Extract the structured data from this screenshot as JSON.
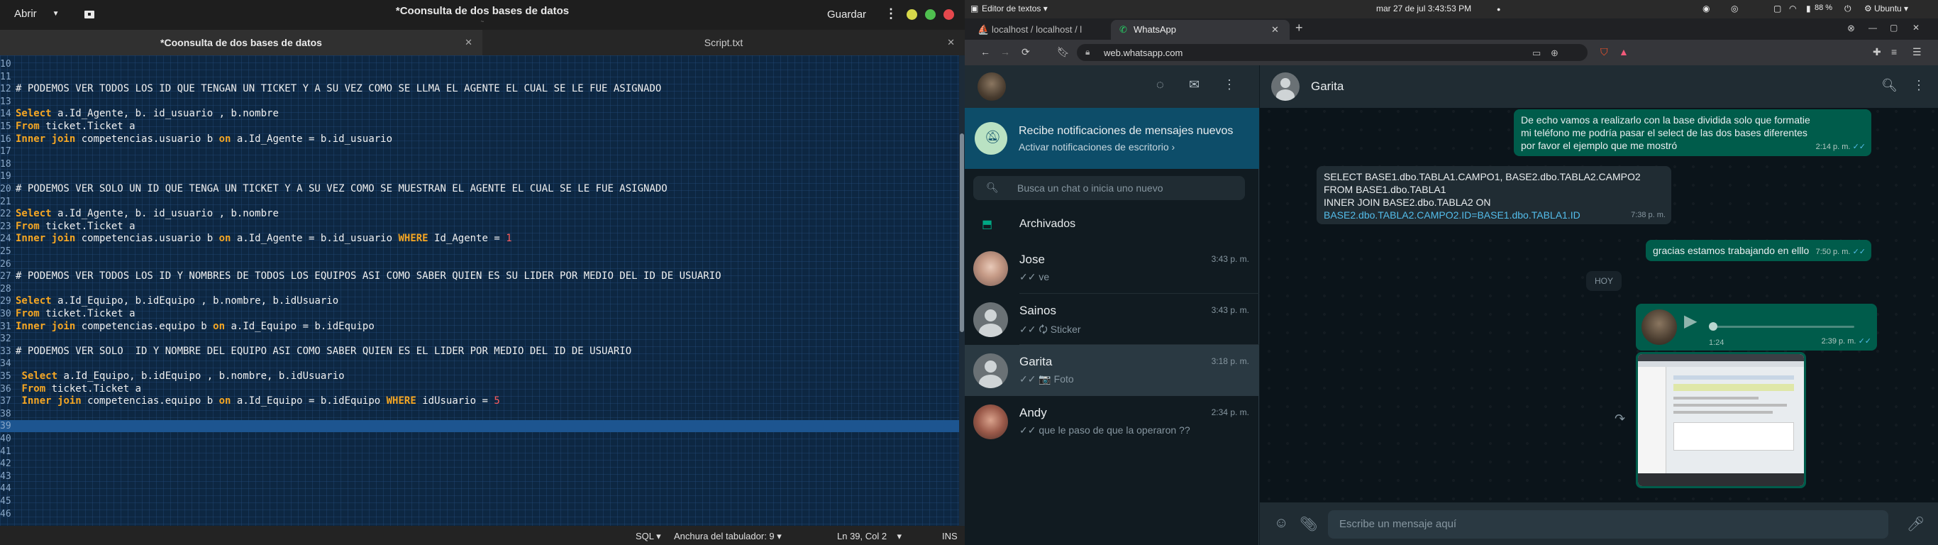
{
  "gedit": {
    "open_label": "Abrir",
    "title": "*Coonsulta de dos bases de datos",
    "subtitle": "~",
    "save_label": "Guardar",
    "tabs": [
      {
        "label": "*Coonsulta de dos bases de datos"
      },
      {
        "label": "Script.txt"
      }
    ],
    "lines": [
      {
        "n": "10",
        "parts": []
      },
      {
        "n": "11",
        "parts": []
      },
      {
        "n": "12",
        "parts": [
          {
            "t": "# PODEMOS VER TODOS LOS ID QUE TENGAN UN TICKET Y A SU VEZ COMO SE LLMA EL AGENTE EL CUAL SE LE FUE ASIGNADO"
          }
        ]
      },
      {
        "n": "13",
        "parts": []
      },
      {
        "n": "14",
        "parts": [
          {
            "t": "Select",
            "c": "kw"
          },
          {
            "t": " a.Id_Agente, b. id_usuario , b.nombre"
          }
        ]
      },
      {
        "n": "15",
        "parts": [
          {
            "t": "From",
            "c": "kw"
          },
          {
            "t": " ticket.Ticket a"
          }
        ]
      },
      {
        "n": "16",
        "parts": [
          {
            "t": "Inner join",
            "c": "kw"
          },
          {
            "t": " competencias.usuario b "
          },
          {
            "t": "on",
            "c": "kw"
          },
          {
            "t": " a.Id_Agente = b.id_usuario"
          }
        ]
      },
      {
        "n": "17",
        "parts": []
      },
      {
        "n": "18",
        "parts": []
      },
      {
        "n": "19",
        "parts": []
      },
      {
        "n": "20",
        "parts": [
          {
            "t": "# PODEMOS VER SOLO UN ID QUE TENGA UN TICKET Y A SU VEZ COMO SE MUESTRAN EL AGENTE EL CUAL SE LE FUE ASIGNADO"
          }
        ]
      },
      {
        "n": "21",
        "parts": []
      },
      {
        "n": "22",
        "parts": [
          {
            "t": "Select",
            "c": "kw"
          },
          {
            "t": " a.Id_Agente, b. id_usuario , b.nombre"
          }
        ]
      },
      {
        "n": "23",
        "parts": [
          {
            "t": "From",
            "c": "kw"
          },
          {
            "t": " ticket.Ticket a"
          }
        ]
      },
      {
        "n": "24",
        "parts": [
          {
            "t": "Inner join",
            "c": "kw"
          },
          {
            "t": " competencias.usuario b "
          },
          {
            "t": "on",
            "c": "kw"
          },
          {
            "t": " a.Id_Agente = b.id_usuario "
          },
          {
            "t": "WHERE",
            "c": "kw"
          },
          {
            "t": " Id_Agente = "
          },
          {
            "t": "1",
            "c": "num"
          }
        ]
      },
      {
        "n": "25",
        "parts": []
      },
      {
        "n": "26",
        "parts": []
      },
      {
        "n": "27",
        "parts": [
          {
            "t": "# PODEMOS VER TODOS LOS ID Y NOMBRES DE TODOS LOS EQUIPOS ASI COMO SABER QUIEN ES SU LIDER POR MEDIO DEL ID DE USUARIO"
          }
        ]
      },
      {
        "n": "28",
        "parts": []
      },
      {
        "n": "29",
        "parts": [
          {
            "t": "Select",
            "c": "kw"
          },
          {
            "t": " a.Id_Equipo, b.idEquipo , b.nombre, b.idUsuario"
          }
        ]
      },
      {
        "n": "30",
        "parts": [
          {
            "t": "From",
            "c": "kw"
          },
          {
            "t": " ticket.Ticket a"
          }
        ]
      },
      {
        "n": "31",
        "parts": [
          {
            "t": "Inner join",
            "c": "kw"
          },
          {
            "t": " competencias.equipo b "
          },
          {
            "t": "on",
            "c": "kw"
          },
          {
            "t": " a.Id_Equipo = b.idEquipo"
          }
        ]
      },
      {
        "n": "32",
        "parts": []
      },
      {
        "n": "33",
        "parts": [
          {
            "t": "# PODEMOS VER SOLO  ID Y NOMBRE DEL EQUIPO ASI COMO SABER QUIEN ES EL LIDER POR MEDIO DEL ID DE USUARIO"
          }
        ]
      },
      {
        "n": "34",
        "parts": []
      },
      {
        "n": "35",
        "parts": [
          {
            "t": " "
          },
          {
            "t": "Select",
            "c": "kw"
          },
          {
            "t": " a.Id_Equipo, b.idEquipo , b.nombre, b.idUsuario"
          }
        ]
      },
      {
        "n": "36",
        "parts": [
          {
            "t": " "
          },
          {
            "t": "From",
            "c": "kw"
          },
          {
            "t": " ticket.Ticket a"
          }
        ]
      },
      {
        "n": "37",
        "parts": [
          {
            "t": " "
          },
          {
            "t": "Inner join",
            "c": "kw"
          },
          {
            "t": " competencias.equipo b "
          },
          {
            "t": "on",
            "c": "kw"
          },
          {
            "t": " a.Id_Equipo = b.idEquipo "
          },
          {
            "t": "WHERE",
            "c": "kw"
          },
          {
            "t": " idUsuario = "
          },
          {
            "t": "5",
            "c": "num"
          }
        ]
      },
      {
        "n": "38",
        "parts": []
      },
      {
        "n": "39",
        "parts": [],
        "current": true
      },
      {
        "n": "40",
        "parts": []
      },
      {
        "n": "41",
        "parts": []
      },
      {
        "n": "42",
        "parts": []
      },
      {
        "n": "43",
        "parts": []
      },
      {
        "n": "44",
        "parts": []
      },
      {
        "n": "45",
        "parts": []
      },
      {
        "n": "46",
        "parts": []
      }
    ],
    "status": {
      "language": "SQL",
      "tab_width": "Anchura del tabulador: 9",
      "position": "Ln 39, Col 2",
      "mode": "INS"
    }
  },
  "system": {
    "app_menu": "Editor de textos",
    "datetime": "mar 27 de jul  3:43:53 PM",
    "battery": "88 %",
    "distro": "Ubuntu"
  },
  "browser": {
    "tabs": [
      {
        "label": "localhost / localhost / l"
      },
      {
        "label": "WhatsApp"
      }
    ],
    "url": "web.whatsapp.com"
  },
  "whatsapp": {
    "notification": {
      "title": "Recibe notificaciones de mensajes nuevos",
      "action": "Activar notificaciones de escritorio ›"
    },
    "search_placeholder": "Busca un chat o inicia uno nuevo",
    "archived_label": "Archivados",
    "chats": [
      {
        "name": "Jose",
        "time": "3:43 p. m.",
        "last": "✓✓ ve"
      },
      {
        "name": "Sainos",
        "time": "3:43 p. m.",
        "last": "✓✓ 🗘 Sticker"
      },
      {
        "name": "Garita",
        "time": "3:18 p. m.",
        "last": "✓✓ 📷 Foto"
      },
      {
        "name": "Andy",
        "time": "2:34 p. m.",
        "last": "✓✓ que le paso de que la operaron ??"
      }
    ],
    "conversation": {
      "contact": "Garita",
      "messages": {
        "m1_text": "De echo vamos a realizarlo con la base dividida solo que formatie mi teléfono me podría pasar el select de las dos bases diferentes por favor el ejemplo que me mostró",
        "m1_time": "2:14 p. m.",
        "m2_l1": "SELECT BASE1.dbo.TABLA1.CAMPO1, BASE2.dbo.TABLA2.CAMPO2",
        "m2_l2": "FROM BASE1.dbo.TABLA1",
        "m2_l3": "INNER JOIN BASE2.dbo.TABLA2 ON",
        "m2_l4": "BASE2.dbo.TABLA2.CAMPO2.ID=BASE1.dbo.TABLA1.ID",
        "m2_time": "7:38 p. m.",
        "m3_text": "gracias estamos trabajando en elllo",
        "m3_time": "7:50 p. m.",
        "day": "HOY",
        "voice_duration": "1:24",
        "voice_time": "2:39 p. m."
      },
      "composer_placeholder": "Escribe un mensaje aquí"
    }
  },
  "colors": {
    "editor_bg": "#0d2742",
    "keyword": "#f5a623",
    "number": "#ff5c5c",
    "wa_outgoing": "#005c4b",
    "wa_incoming": "#202c33",
    "wa_accent": "#00a884"
  }
}
